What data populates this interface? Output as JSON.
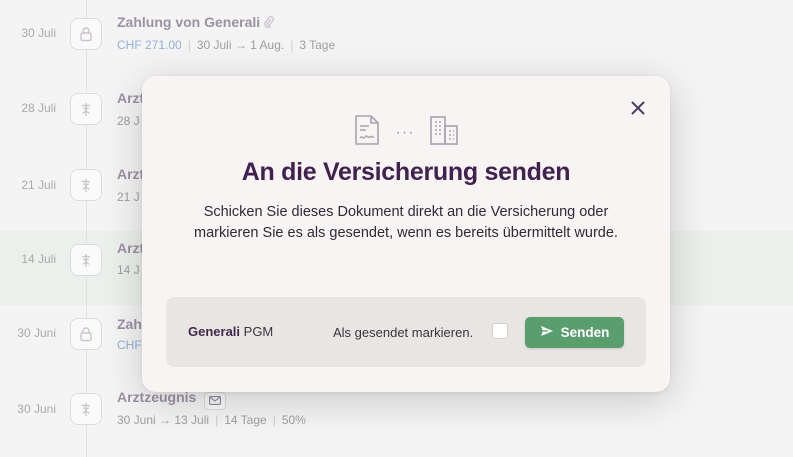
{
  "timeline": {
    "rows": [
      {
        "date": "30 Juli",
        "title": "Zahlung von Generali",
        "amount": "CHF 271.00",
        "period": "30 Juli → 1 Aug.",
        "duration": "3 Tage",
        "icon": "lock-icon"
      },
      {
        "date": "28 Juli",
        "title": "Arzt",
        "meta": "28 J",
        "icon": "caduceus-icon"
      },
      {
        "date": "21 Juli",
        "title": "Arzt",
        "meta": "21 J",
        "icon": "caduceus-icon"
      },
      {
        "date": "14 Juli",
        "title": "Arzt",
        "meta": "14 J",
        "icon": "caduceus-icon"
      },
      {
        "date": "30 Juni",
        "title": "Zah",
        "meta": "CHF",
        "icon": "lock-icon"
      },
      {
        "date": "30 Juni",
        "title": "Arztzeugnis",
        "period": "30 Juni → 13 Juli",
        "duration": "14 Tage",
        "percent": "50%",
        "icon": "caduceus-icon"
      }
    ]
  },
  "modal": {
    "title": "An die Versicherung senden",
    "description": "Schicken Sie dieses Dokument direkt an die Versicherung oder markieren Sie es als gesendet, wenn es bereits übermittelt wurde.",
    "icons": [
      "document-icon",
      "dots-icon",
      "building-icon"
    ],
    "dots": "···",
    "insurer_bold": "Generali",
    "insurer_rest": " PGM",
    "mark_label": "Als gesendet markieren.",
    "checkbox_checked": false,
    "send_label": "Senden",
    "colors": {
      "title": "#40214f",
      "send_button": "#5a9e6e"
    }
  }
}
